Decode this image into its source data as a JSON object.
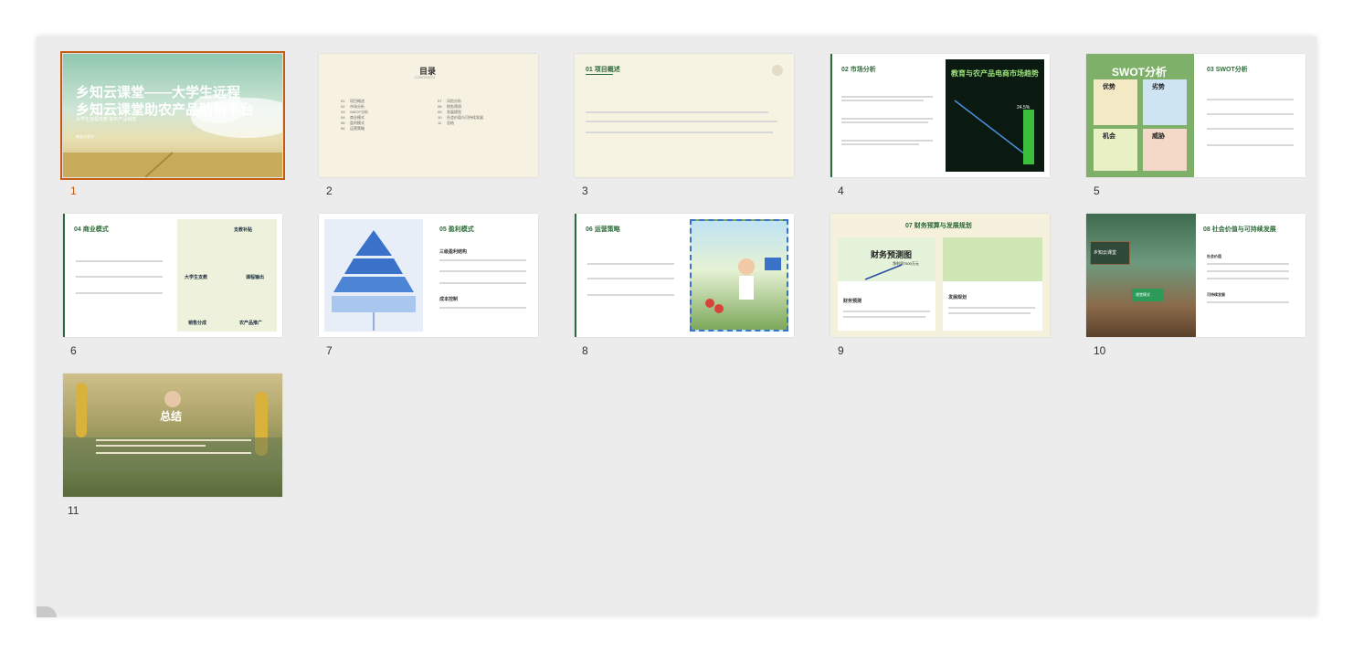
{
  "slides": [
    {
      "number": "1",
      "title": "乡知云课堂——大学生远程",
      "title2": "乡知云课堂助农产品助销平台",
      "subtitle": "大学生远程支教 助农产品销售",
      "footer": "商业计划书"
    },
    {
      "number": "2",
      "title": "目录",
      "subtitle": "CONTENTS",
      "items_left": [
        "01",
        "02",
        "03",
        "04",
        "05",
        "06"
      ],
      "labels_left": [
        "项目概述",
        "市场分析",
        "SWOT分析",
        "商业模式",
        "盈利模式",
        "运营策略"
      ],
      "items_right": [
        "07",
        "08",
        "09",
        "10",
        "11"
      ],
      "labels_right": [
        "风险分析",
        "财务预测",
        "发展规划",
        "社会价值与可持续发展",
        "总结"
      ]
    },
    {
      "number": "3",
      "title": "01 项目概述"
    },
    {
      "number": "4",
      "title": "02 市场分析",
      "image_title": "教育与农产品电商市场趋势",
      "badge": "24.5%"
    },
    {
      "number": "5",
      "title": "03 SWOT分析",
      "image_title": "SWOT分析",
      "q1": "优势",
      "q2": "劣势",
      "q3": "机会",
      "q4": "威胁"
    },
    {
      "number": "6",
      "title": "04 商业模式",
      "b1": "支教补贴",
      "b2": "大学生支教",
      "b3": "课程输出",
      "b4": "销售分成",
      "b5": "农产品推广"
    },
    {
      "number": "7",
      "title": "05 盈利模式",
      "sub1": "三级盈利结构",
      "sub2": "成本控制"
    },
    {
      "number": "8",
      "title": "06 运营策略"
    },
    {
      "number": "9",
      "title": "07 财务预算与发展规划",
      "chart_title": "财务预测图",
      "chart_value": "净利润7500万元",
      "left_head": "财务预测",
      "right_head": "发展规划"
    },
    {
      "number": "10",
      "title": "08 社会价值与可持续发展",
      "board": "乡知云课堂",
      "screen": "课堂模式",
      "s1": "社会价值",
      "s2": "可持续发展"
    },
    {
      "number": "11",
      "title": "总结"
    }
  ],
  "colors": {
    "accent": "#c55a11",
    "green": "#2e6b3a",
    "panel": "#ececec"
  }
}
